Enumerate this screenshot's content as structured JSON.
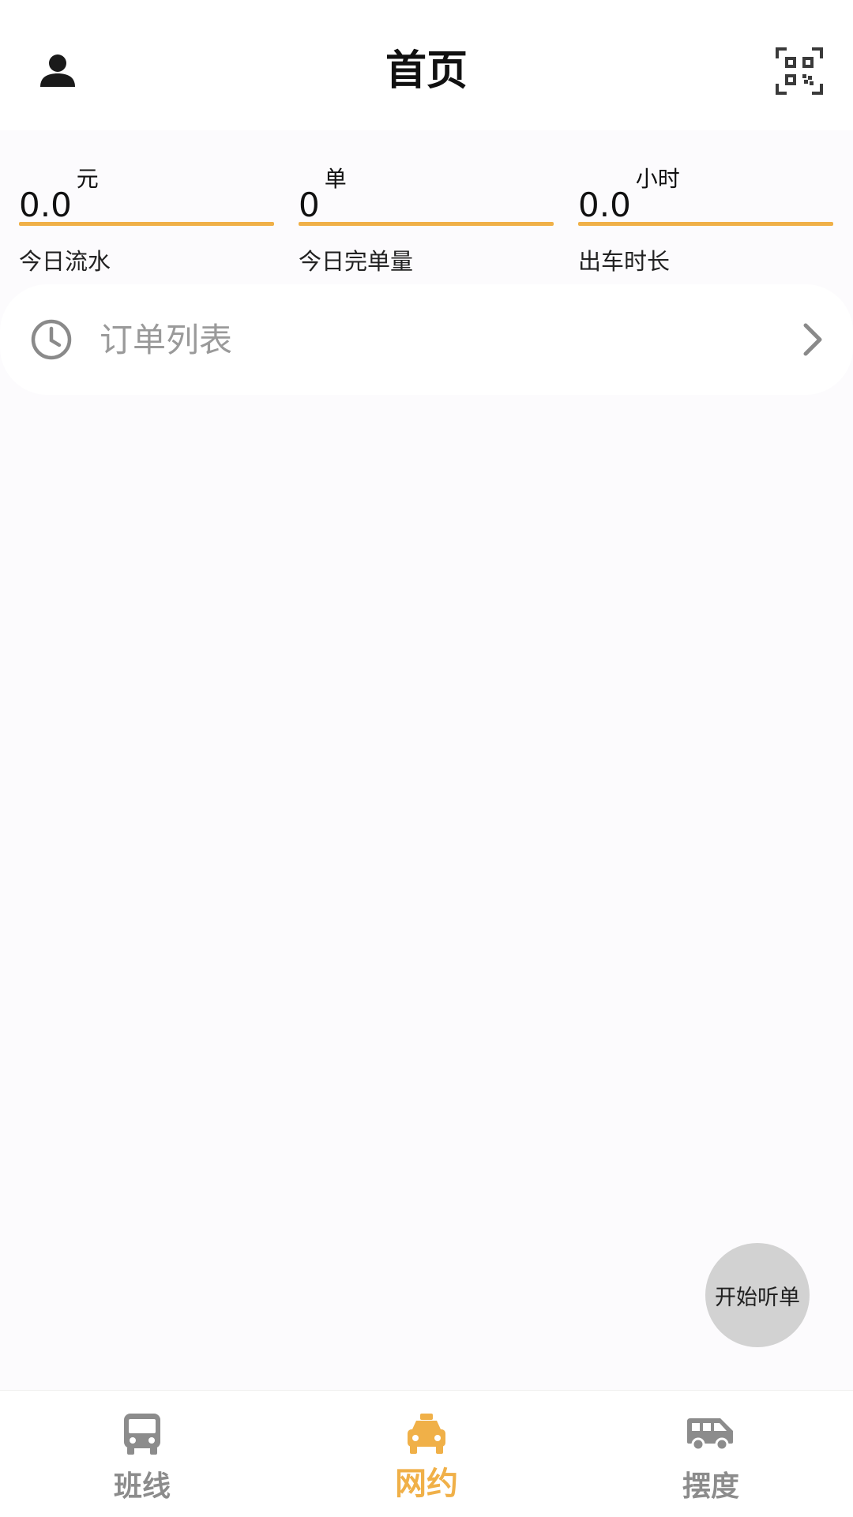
{
  "header": {
    "title": "首页",
    "user_icon": "person-icon",
    "scan_icon": "qr-scan-icon"
  },
  "stats": [
    {
      "value": "0.0",
      "unit": "元",
      "label": "今日流水"
    },
    {
      "value": "0",
      "unit": "单",
      "label": "今日完单量"
    },
    {
      "value": "0.0",
      "unit": "小时",
      "label": "出车时长"
    }
  ],
  "order_list": {
    "label": "订单列表",
    "icon": "clock-icon",
    "chevron": "chevron-right-icon"
  },
  "listen_button": {
    "label": "开始听单"
  },
  "tabs": [
    {
      "label": "班线",
      "icon": "bus-icon",
      "active": false
    },
    {
      "label": "网约",
      "icon": "taxi-icon",
      "active": true
    },
    {
      "label": "摆度",
      "icon": "van-icon",
      "active": false
    }
  ],
  "colors": {
    "accent": "#f0b048",
    "inactive_tab": "#8c8c8c",
    "background": "#fcfbfd",
    "listen_button_bg": "#d2d2d2"
  }
}
